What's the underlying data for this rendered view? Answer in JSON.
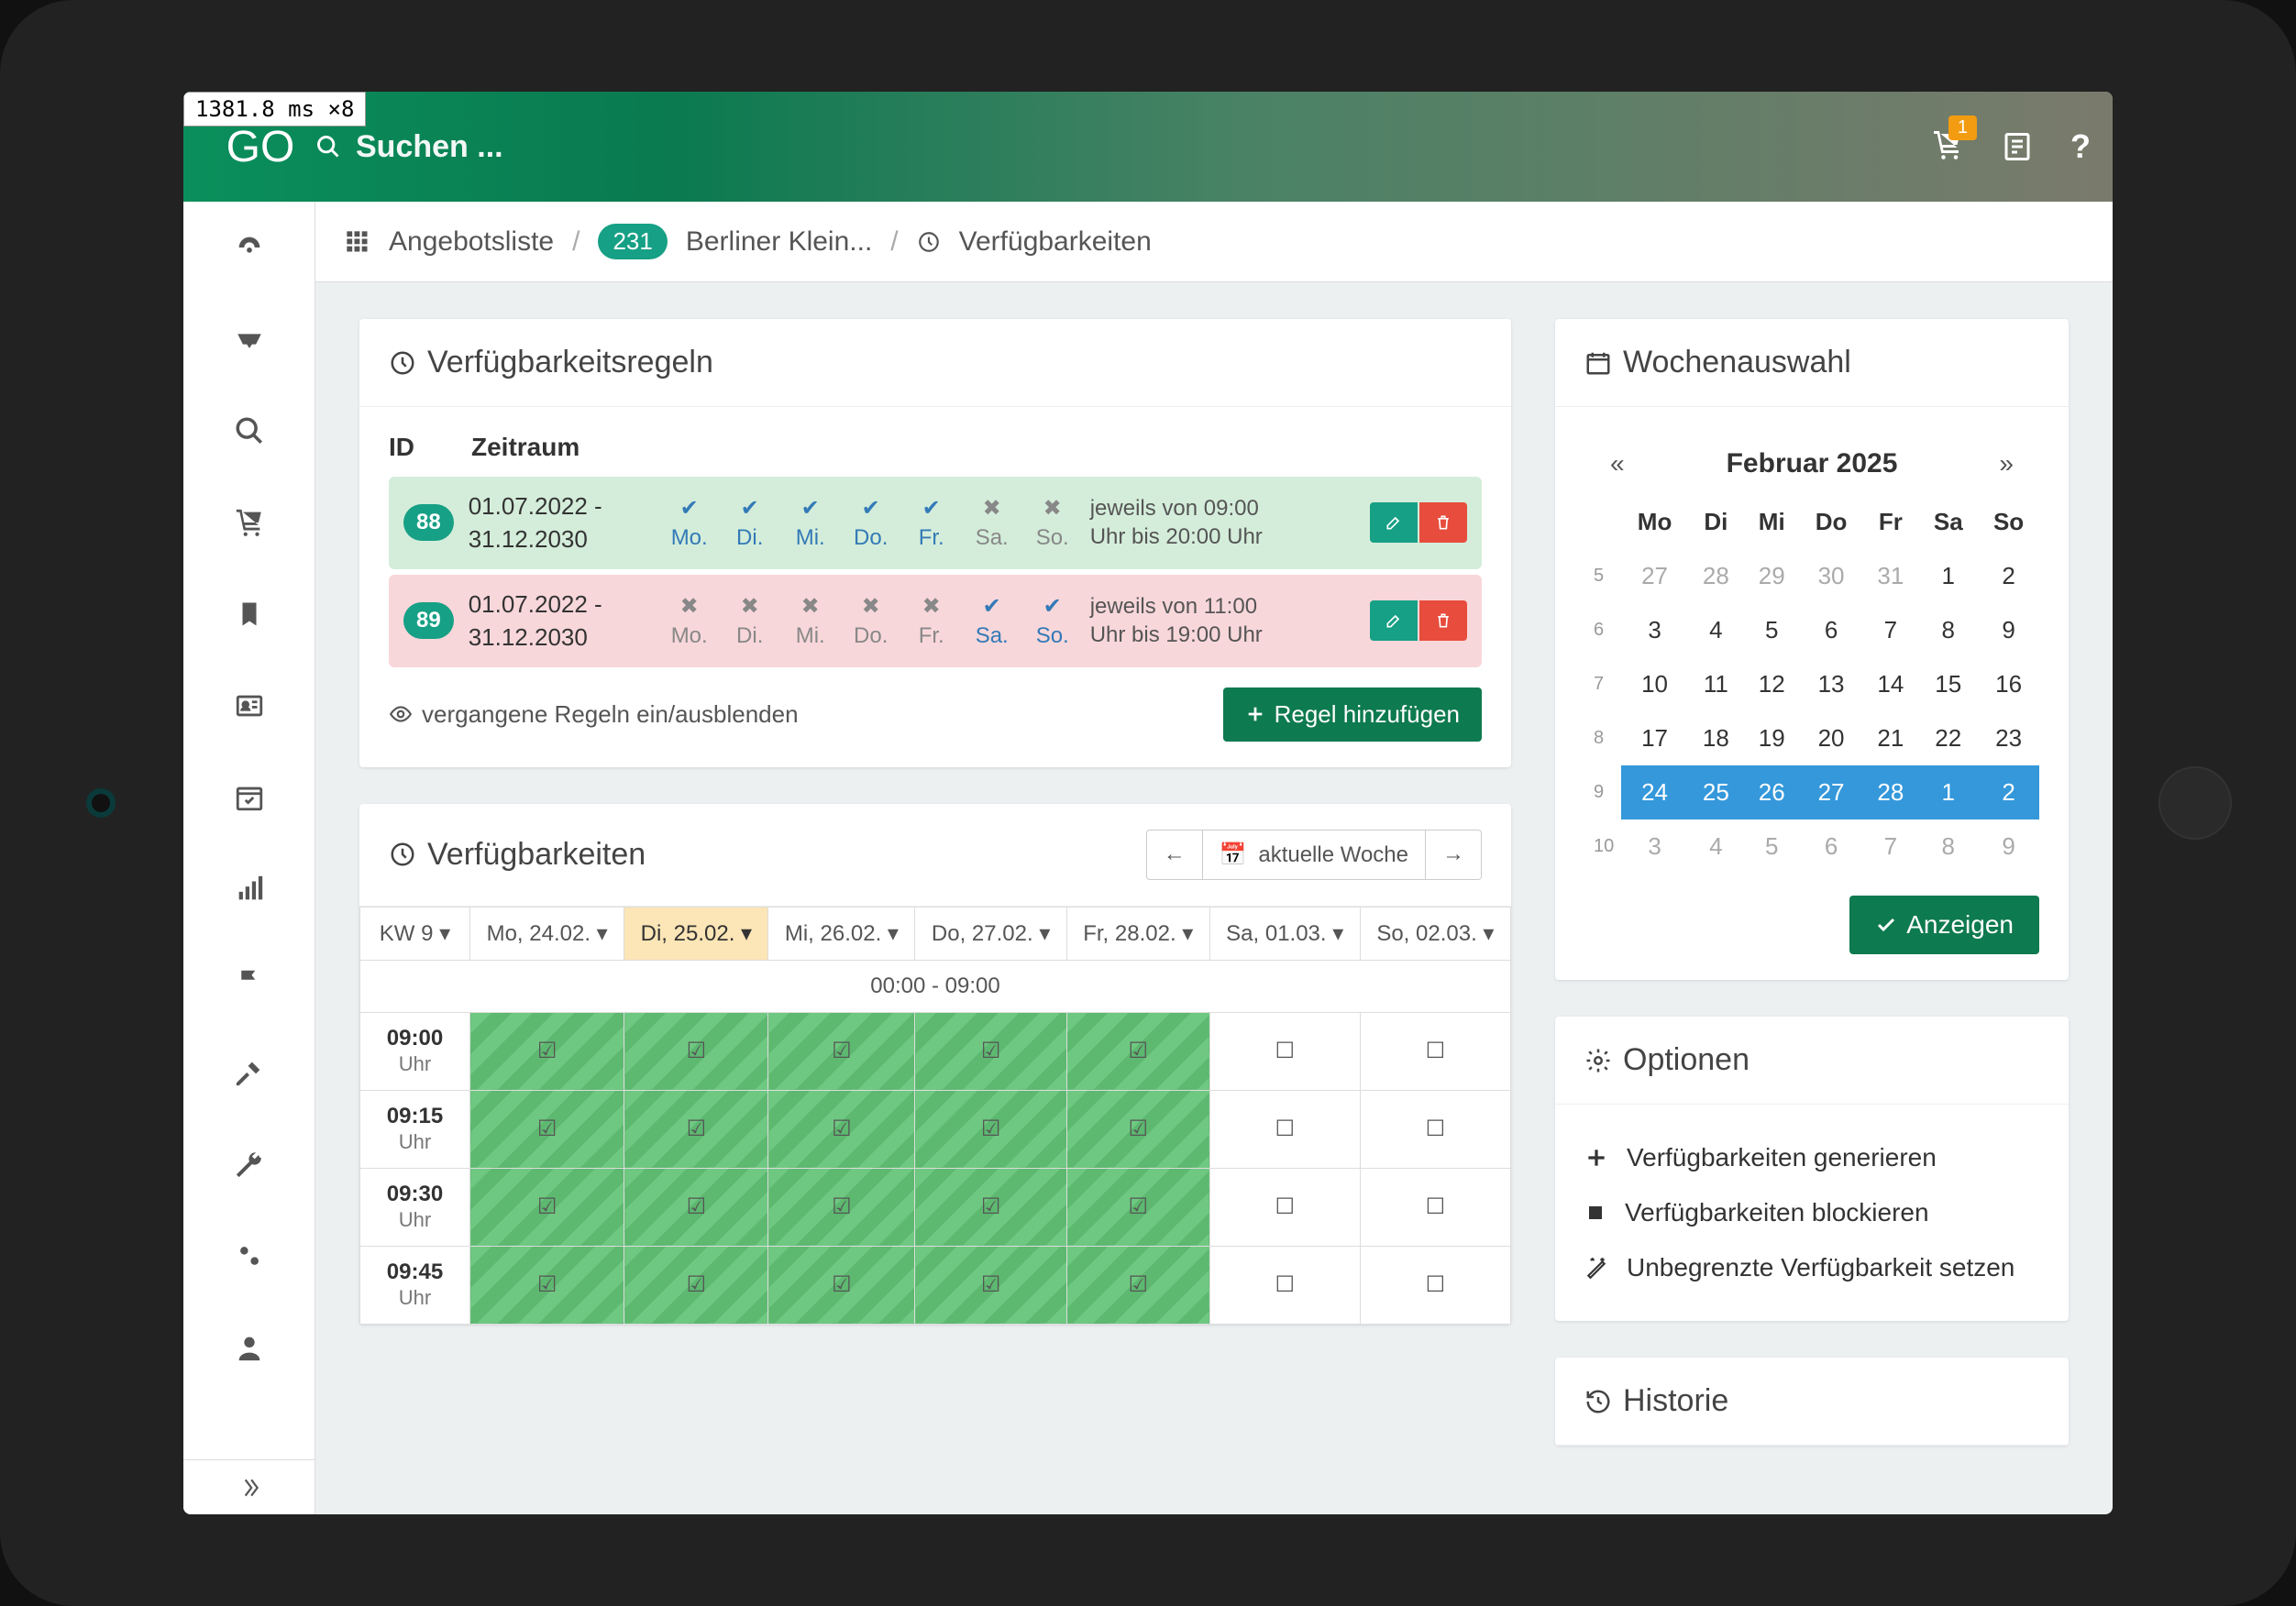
{
  "debug": {
    "text": "1381.8 ms ×8"
  },
  "header": {
    "logo": "GO",
    "search_placeholder": "Suchen ...",
    "cart_count": "1",
    "help": "?"
  },
  "breadcrumb": {
    "angebotsliste": "Angebotsliste",
    "pill": "231",
    "item_name": "Berliner Klein...",
    "verf": "Verfügbarkeiten"
  },
  "rules": {
    "title": "Verfügbarkeitsregeln",
    "col_id": "ID",
    "col_zeit": "Zeitraum",
    "days": [
      "Mo.",
      "Di.",
      "Mi.",
      "Do.",
      "Fr.",
      "Sa.",
      "So."
    ],
    "rows": [
      {
        "id": "88",
        "date_from": "01.07.2022 -",
        "date_to": "31.12.2030",
        "days_on": [
          true,
          true,
          true,
          true,
          true,
          false,
          false
        ],
        "desc1": "jeweils von 09:00",
        "desc2": "Uhr bis 20:00 Uhr",
        "tone": "green"
      },
      {
        "id": "89",
        "date_from": "01.07.2022 -",
        "date_to": "31.12.2030",
        "days_on": [
          false,
          false,
          false,
          false,
          false,
          true,
          true
        ],
        "desc1": "jeweils von 11:00",
        "desc2": "Uhr bis 19:00 Uhr",
        "tone": "red"
      }
    ],
    "toggle_past": "vergangene Regeln ein/ausblenden",
    "add_rule": "Regel hinzufügen"
  },
  "avail": {
    "title": "Verfügbarkeiten",
    "current_week": "aktuelle Woche",
    "kw": "KW 9",
    "headers": [
      "Mo, 24.02.",
      "Di, 25.02.",
      "Mi, 26.02.",
      "Do, 27.02.",
      "Fr, 28.02.",
      "Sa, 01.03.",
      "So, 02.03."
    ],
    "active_idx": 1,
    "range_label": "00:00 - 09:00",
    "rows": [
      {
        "time": "09:00",
        "sub": "Uhr",
        "cells": [
          true,
          true,
          true,
          true,
          true,
          false,
          false
        ]
      },
      {
        "time": "09:15",
        "sub": "Uhr",
        "cells": [
          true,
          true,
          true,
          true,
          true,
          false,
          false
        ]
      },
      {
        "time": "09:30",
        "sub": "Uhr",
        "cells": [
          true,
          true,
          true,
          true,
          true,
          false,
          false
        ]
      },
      {
        "time": "09:45",
        "sub": "Uhr",
        "cells": [
          true,
          true,
          true,
          true,
          true,
          false,
          false
        ]
      }
    ]
  },
  "calendar": {
    "title": "Wochenauswahl",
    "month": "Februar 2025",
    "dow": [
      "Mo",
      "Di",
      "Mi",
      "Do",
      "Fr",
      "Sa",
      "So"
    ],
    "weeks": [
      {
        "wk": "5",
        "days": [
          {
            "n": "27",
            "m": true
          },
          {
            "n": "28",
            "m": true
          },
          {
            "n": "29",
            "m": true
          },
          {
            "n": "30",
            "m": true
          },
          {
            "n": "31",
            "m": true
          },
          {
            "n": "1"
          },
          {
            "n": "2"
          }
        ]
      },
      {
        "wk": "6",
        "days": [
          {
            "n": "3"
          },
          {
            "n": "4"
          },
          {
            "n": "5"
          },
          {
            "n": "6"
          },
          {
            "n": "7"
          },
          {
            "n": "8"
          },
          {
            "n": "9"
          }
        ]
      },
      {
        "wk": "7",
        "days": [
          {
            "n": "10"
          },
          {
            "n": "11"
          },
          {
            "n": "12"
          },
          {
            "n": "13"
          },
          {
            "n": "14"
          },
          {
            "n": "15"
          },
          {
            "n": "16"
          }
        ]
      },
      {
        "wk": "8",
        "days": [
          {
            "n": "17"
          },
          {
            "n": "18"
          },
          {
            "n": "19"
          },
          {
            "n": "20"
          },
          {
            "n": "21"
          },
          {
            "n": "22"
          },
          {
            "n": "23"
          }
        ]
      },
      {
        "wk": "9",
        "sel": true,
        "days": [
          {
            "n": "24"
          },
          {
            "n": "25"
          },
          {
            "n": "26"
          },
          {
            "n": "27"
          },
          {
            "n": "28"
          },
          {
            "n": "1"
          },
          {
            "n": "2"
          }
        ]
      },
      {
        "wk": "10",
        "days": [
          {
            "n": "3",
            "m": true
          },
          {
            "n": "4",
            "m": true
          },
          {
            "n": "5",
            "m": true
          },
          {
            "n": "6",
            "m": true
          },
          {
            "n": "7",
            "m": true
          },
          {
            "n": "8",
            "m": true
          },
          {
            "n": "9",
            "m": true
          }
        ]
      }
    ],
    "show": "Anzeigen"
  },
  "options": {
    "title": "Optionen",
    "items": [
      {
        "icon": "plus",
        "label": "Verfügbarkeiten generieren"
      },
      {
        "icon": "square",
        "label": "Verfügbarkeiten blockieren"
      },
      {
        "icon": "wand",
        "label": "Unbegrenzte Verfügbarkeit setzen"
      }
    ]
  },
  "history": {
    "title": "Historie"
  }
}
